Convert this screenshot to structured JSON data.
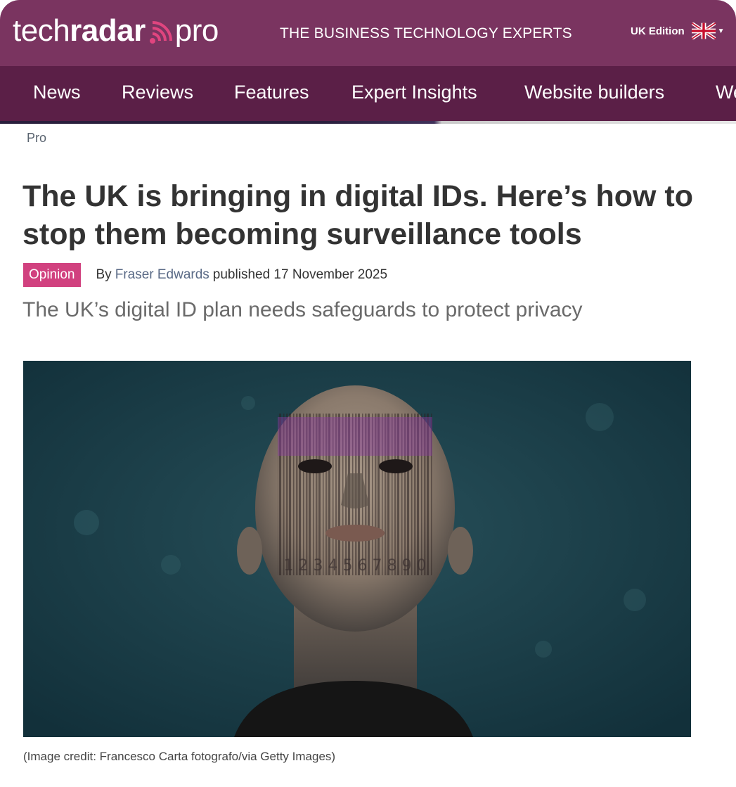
{
  "brand": {
    "logo_part1": "tech",
    "logo_part2": "radar",
    "logo_part3": "pro",
    "tagline": "THE BUSINESS TECHNOLOGY EXPERTS",
    "edition": "UK Edition",
    "accent_color": "#7a3460",
    "nav_color": "#5b1f47"
  },
  "nav": {
    "items": [
      {
        "label": "News"
      },
      {
        "label": "Reviews"
      },
      {
        "label": "Features"
      },
      {
        "label": "Expert Insights"
      },
      {
        "label": "Website builders"
      },
      {
        "label": "We"
      }
    ]
  },
  "article": {
    "breadcrumb": "Pro",
    "title": "The UK is bringing in digital IDs. Here’s how to stop them becoming surveillance tools",
    "tag": "Opinion",
    "tag_color": "#d1417f",
    "by": "By",
    "author": "Fraser Edwards",
    "published": "published 17 November 2025",
    "standfirst": "The UK’s digital ID plan needs safeguards to protect privacy",
    "barcode_digits": "1 2 3 4 5 6 7 8 9 0",
    "image_credit": "(Image credit: Francesco Carta fotografo/via Getty Images)"
  }
}
